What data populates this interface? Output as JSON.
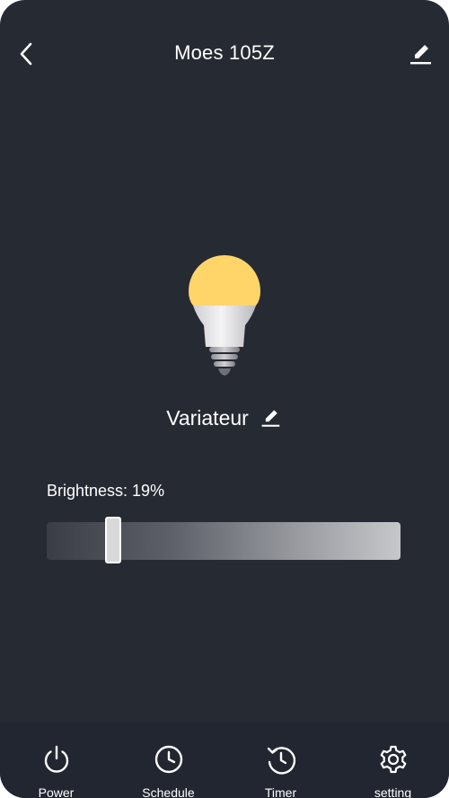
{
  "header": {
    "title": "Moes 105Z",
    "back_icon": "chevron-left-icon",
    "edit_icon": "pencil-icon"
  },
  "device": {
    "icon": "light-bulb-icon",
    "bulb_color": "#ffd56a",
    "mode_label": "Variateur",
    "mode_edit_icon": "pencil-icon"
  },
  "brightness": {
    "label": "Brightness: 19%",
    "value_fraction": 0.19
  },
  "tabbar": {
    "tabs": [
      {
        "label": "Power",
        "icon": "power-icon"
      },
      {
        "label": "Schedule",
        "icon": "clock-icon"
      },
      {
        "label": "Timer",
        "icon": "timer-icon"
      },
      {
        "label": "setting",
        "icon": "gear-icon"
      }
    ]
  },
  "colors": {
    "background": "#262a33",
    "tabbar_background": "#222630",
    "text": "#ffffff"
  }
}
